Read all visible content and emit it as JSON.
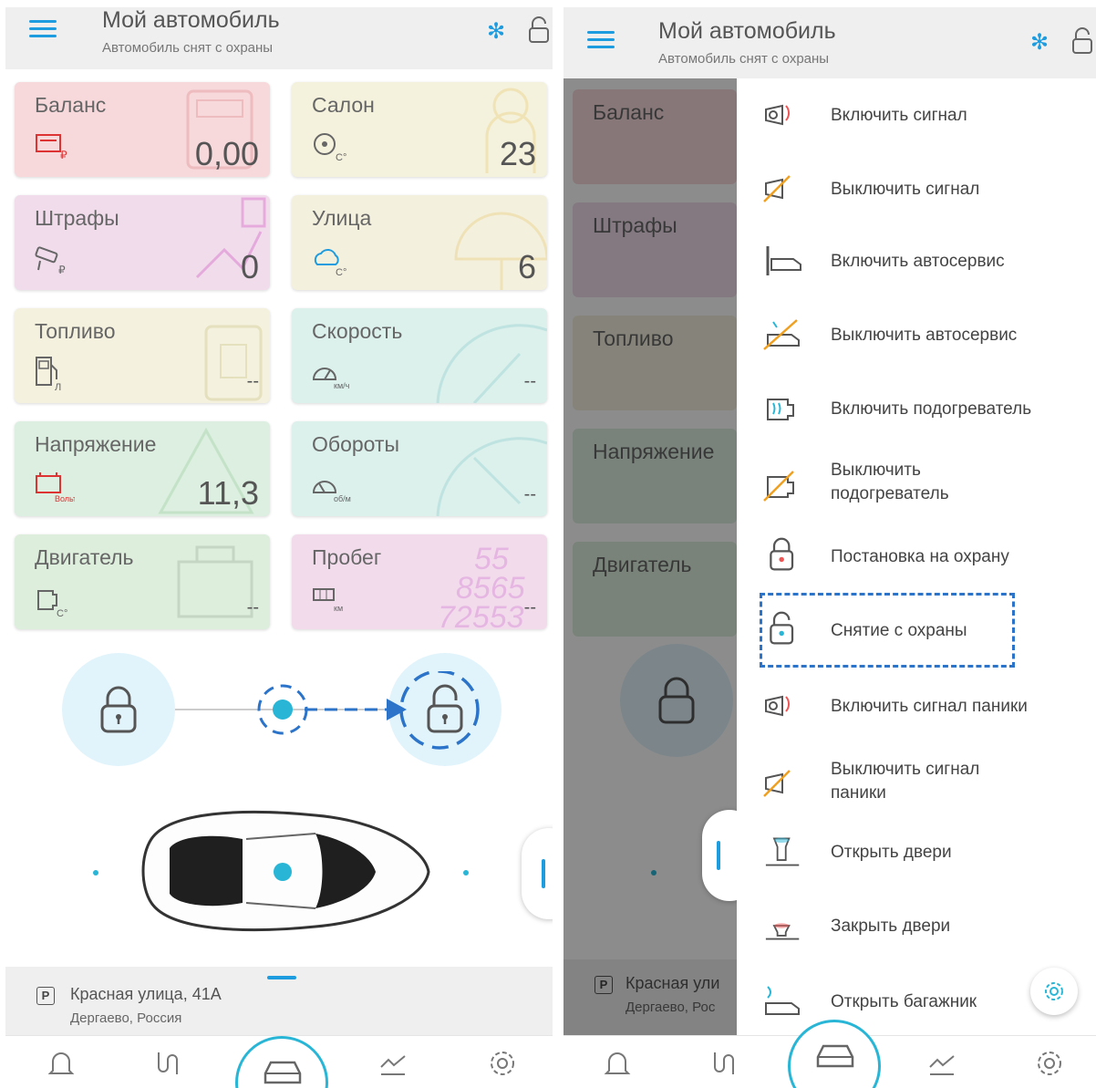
{
  "header": {
    "title": "Мой автомобиль",
    "subtitle": "Автомобиль снят с охраны"
  },
  "tiles": [
    {
      "label": "Баланс",
      "value": "0,00",
      "unit": "₽",
      "color": "#f7d9dc"
    },
    {
      "label": "Салон",
      "value": "23",
      "unit": "C°",
      "color": "#f4f1dc"
    },
    {
      "label": "Штрафы",
      "value": "0",
      "unit": "₽",
      "color": "#f1dcec"
    },
    {
      "label": "Улица",
      "value": "6",
      "unit": "C°",
      "color": "#f4f0de"
    },
    {
      "label": "Топливо",
      "value": "--",
      "unit": "Л",
      "color": "#f4f1de"
    },
    {
      "label": "Скорость",
      "value": "--",
      "unit": "км/ч",
      "color": "#dcf0ec"
    },
    {
      "label": "Напряжение",
      "value": "11,3",
      "unit": "Вольт",
      "color": "#dcefe0"
    },
    {
      "label": "Обороты",
      "value": "--",
      "unit": "об/м",
      "color": "#dcf0ec"
    },
    {
      "label": "Двигатель",
      "value": "--",
      "unit": "C°",
      "color": "#ddeedd"
    },
    {
      "label": "Пробег",
      "value": "--",
      "unit": "км",
      "color": "#f2dcec"
    }
  ],
  "address": {
    "parking_badge": "P",
    "street": "Красная улица, 41А",
    "city": "Дергаево, Россия",
    "street_cut": "Красная ули",
    "city_cut": "Дергаево, Рос"
  },
  "menu": [
    {
      "label": "Включить сигнал",
      "icon": "horn-icon"
    },
    {
      "label": "Выключить сигнал",
      "icon": "horn-off-icon"
    },
    {
      "label": "Включить автосервис",
      "icon": "service-icon"
    },
    {
      "label": "Выключить автосервис",
      "icon": "service-off-icon"
    },
    {
      "label": "Включить подогреватель",
      "icon": "heater-icon"
    },
    {
      "label": "Выключить подогреватель",
      "icon": "heater-off-icon"
    },
    {
      "label": "Постановка на охрану",
      "icon": "lock-icon"
    },
    {
      "label": "Снятие с охраны",
      "icon": "unlock-icon"
    },
    {
      "label": "Включить сигнал паники",
      "icon": "panic-icon"
    },
    {
      "label": "Выключить сигнал паники",
      "icon": "panic-off-icon"
    },
    {
      "label": "Открыть двери",
      "icon": "door-open-icon"
    },
    {
      "label": "Закрыть двери",
      "icon": "door-close-icon"
    },
    {
      "label": "Открыть багажник",
      "icon": "trunk-icon"
    }
  ],
  "menu_split": {
    "heater_off_1": "Выключить",
    "heater_off_2": "подогреватель",
    "panic_off_1": "Выключить сигнал",
    "panic_off_2": "паники"
  },
  "colors": {
    "accent": "#1e9ce0",
    "highlight_dash": "#2c74c9",
    "car_ring": "#29b6d6"
  }
}
